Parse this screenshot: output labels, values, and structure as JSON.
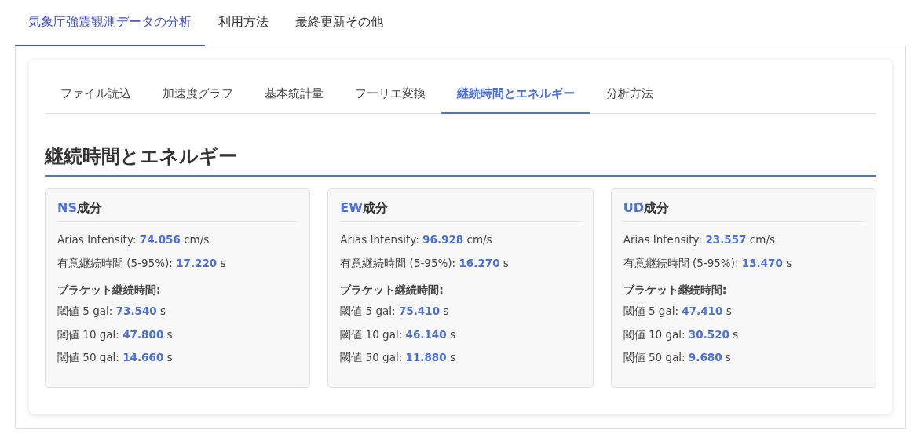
{
  "main_tabs": [
    {
      "label": "気象庁強震観測データの分析",
      "selected": true
    },
    {
      "label": "利用方法",
      "selected": false
    },
    {
      "label": "最終更新その他",
      "selected": false
    }
  ],
  "sub_tabs": [
    {
      "label": "ファイル読込",
      "selected": false
    },
    {
      "label": "加速度グラフ",
      "selected": false
    },
    {
      "label": "基本統計量",
      "selected": false
    },
    {
      "label": "フーリエ変換",
      "selected": false
    },
    {
      "label": "継続時間とエネルギー",
      "selected": true
    },
    {
      "label": "分析方法",
      "selected": false
    }
  ],
  "heading": "継続時間とエネルギー",
  "cards": [
    {
      "title": "**NS**成分",
      "lines": [
        "Arias Intensity: **74.056** cm/s",
        "有意継続時間 (5-95%): **17.220** s"
      ],
      "subheading": "ブラケット継続時間:",
      "thresholds": [
        "閾値 5 gal: **73.540** s",
        "閾値 10 gal: **47.800** s",
        "閾値 50 gal: **14.660** s"
      ]
    },
    {
      "title": "**EW**成分",
      "lines": [
        "Arias Intensity: **96.928** cm/s",
        "有意継続時間 (5-95%): **16.270** s"
      ],
      "subheading": "ブラケット継続時間:",
      "thresholds": [
        "閾値 5 gal: **75.410** s",
        "閾値 10 gal: **46.140** s",
        "閾値 50 gal: **11.880** s"
      ]
    },
    {
      "title": "**UD**成分",
      "lines": [
        "Arias Intensity: **23.557** cm/s",
        "有意継続時間 (5-95%): **13.470** s"
      ],
      "subheading": "ブラケット継続時間:",
      "thresholds": [
        "閾値 5 gal: **47.410** s",
        "閾値 10 gal: **30.520** s",
        "閾値 50 gal: **9.680** s"
      ]
    }
  ]
}
